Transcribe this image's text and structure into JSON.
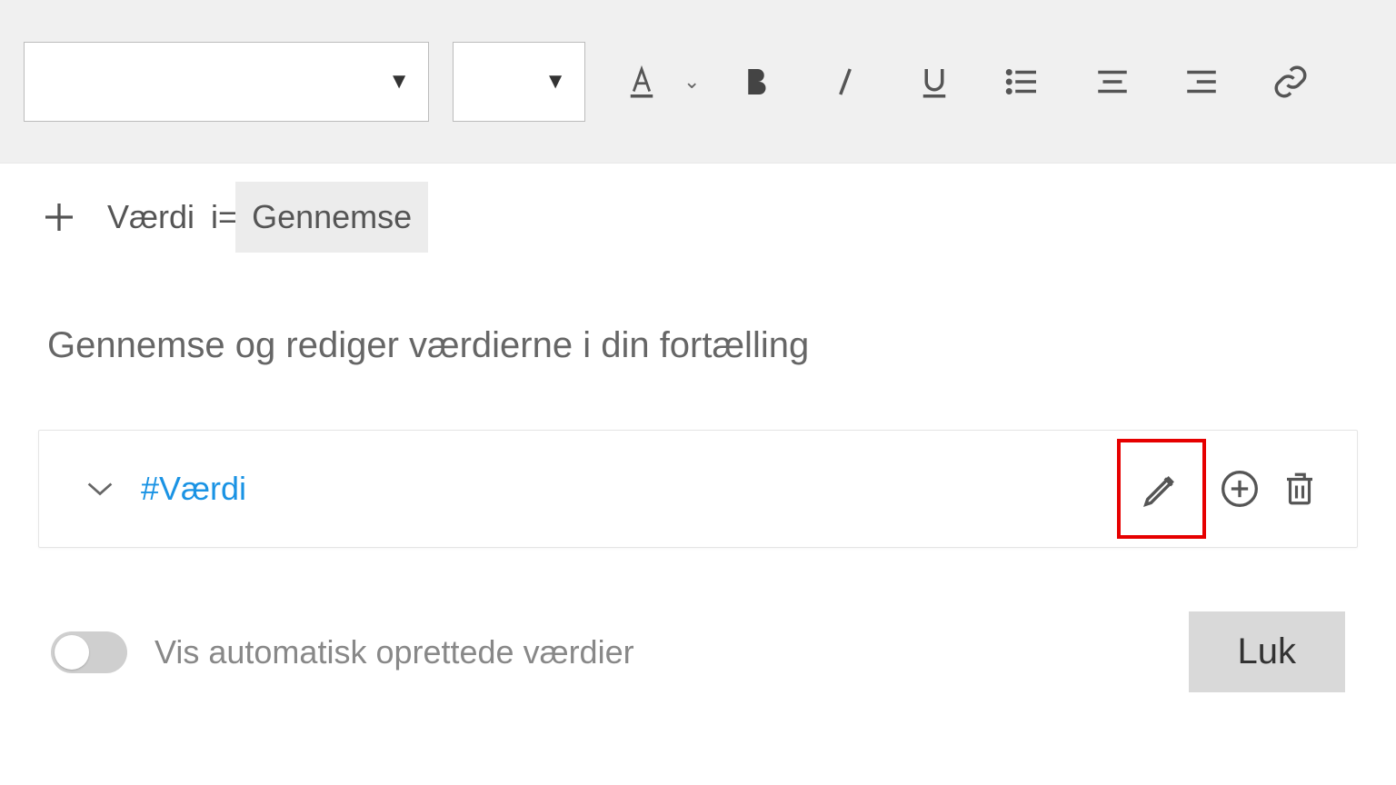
{
  "toolbar": {
    "font_dropdown": "",
    "size_dropdown": ""
  },
  "tabs": {
    "add_label": "Værdi",
    "separator": "i=",
    "active_tab": "Gennemse"
  },
  "heading": "Gennemse og rediger værdierne i din fortælling",
  "value_row": {
    "label": "#Værdi"
  },
  "footer": {
    "toggle_label": "Vis automatisk oprettede værdier",
    "close_label": "Luk"
  }
}
